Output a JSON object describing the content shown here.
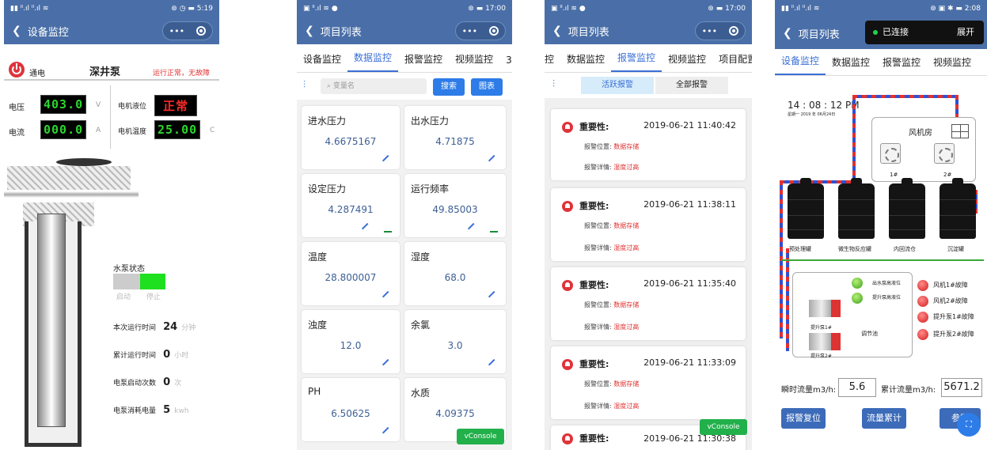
{
  "p1": {
    "status": {
      "left": "▮▮ ᴵᴵ.ıl ᴵᴵ.ıl ≋",
      "right": "⊛ ◷ ▬ 5:19"
    },
    "title": "设备监控",
    "power": "通电",
    "pump_name": "深井泵",
    "run_status": "运行正常，无故障",
    "voltage_label": "电压",
    "voltage": "403.0",
    "voltage_unit": "V",
    "current_label": "电流",
    "current": "000.0",
    "current_unit": "A",
    "level_label": "电机液位",
    "level": "正常",
    "temp_label": "电机温度",
    "temp": "25.00",
    "temp_unit": "C",
    "pump_state": "水泵状态",
    "start": "启动",
    "stop": "停止",
    "rows": [
      {
        "label": "本次运行时间",
        "value": "24",
        "unit": "分钟"
      },
      {
        "label": "累计运行时间",
        "value": "0",
        "unit": "小时"
      },
      {
        "label": "电泵启动次数",
        "value": "0",
        "unit": "次"
      },
      {
        "label": "电泵消耗电量",
        "value": "5",
        "unit": "kwh"
      }
    ]
  },
  "p2": {
    "status": {
      "left": "▣ ᴵᴵ.ıl ≋ ●",
      "right": "⊛ ▬ 17:00"
    },
    "title": "项目列表",
    "tabs": [
      "设备监控",
      "数据监控",
      "报警监控",
      "视频监控",
      "3"
    ],
    "search_placeholder": "变量名",
    "search": "搜索",
    "chart": "图表",
    "cards": [
      {
        "t": "进水压力",
        "v": "4.6675167"
      },
      {
        "t": "出水压力",
        "v": "4.71875"
      },
      {
        "t": "设定压力",
        "v": "4.287491"
      },
      {
        "t": "运行频率",
        "v": "49.85003"
      },
      {
        "t": "温度",
        "v": "28.800007"
      },
      {
        "t": "湿度",
        "v": "68.0"
      },
      {
        "t": "浊度",
        "v": "12.0"
      },
      {
        "t": "余氯",
        "v": "3.0"
      },
      {
        "t": "PH",
        "v": "6.50625"
      },
      {
        "t": "水质",
        "v": "4.09375"
      }
    ],
    "vconsole": "vConsole"
  },
  "p3": {
    "status": {
      "left": "▣ ᴵᴵ.ıl ≋ ●",
      "right": "⊛ ▬ 17:00"
    },
    "title": "项目列表",
    "tabs": [
      "控",
      "数据监控",
      "报警监控",
      "视频监控",
      "项目配置"
    ],
    "active": "活跃报警",
    "all": "全部报警",
    "alarms": [
      {
        "sev": "重要性:",
        "time": "2019-06-21 11:40:42"
      },
      {
        "sev": "重要性:",
        "time": "2019-06-21 11:38:11"
      },
      {
        "sev": "重要性:",
        "time": "2019-06-21 11:35:40"
      },
      {
        "sev": "重要性:",
        "time": "2019-06-21 11:33:09"
      },
      {
        "sev": "重要性:",
        "time": "2019-06-21 11:30:38"
      }
    ],
    "loc_label": "报警位置:",
    "loc": "数据存储",
    "det_label": "报警详情:",
    "det": "湿度过高",
    "vconsole": "vConsole"
  },
  "p4": {
    "status": {
      "left": "▮▮ ᴵᴵ.ıl ᴵᴵ.ıl ≋",
      "right": "⊛ ▣ ✱ ▬ 2:08"
    },
    "title": "项目列表",
    "connected": "已连接",
    "expand": "展开",
    "tabs": [
      "设备监控",
      "数据监控",
      "报警监控",
      "视频监控"
    ],
    "clock": "14 : 08 : 12  PM",
    "date": "星期一  2019 年 06月24日",
    "fan_room": "风机房",
    "fan1": "1#",
    "fan2": "2#",
    "tanks": [
      "预处理罐",
      "微生物反应罐",
      "内回流仓",
      "沉淀罐"
    ],
    "pump1": "提升泵1#",
    "pump2": "提升泵2#",
    "pool": "调节池",
    "high1": "出水泵高液位",
    "high2": "提升泵高液位",
    "faults": [
      "风机1#故障",
      "风机2#故障",
      "提升泵1#故障",
      "提升泵2#故障"
    ],
    "flow_label": "瞬时流量m3/h:",
    "flow": "5.6",
    "total_label": "累计流量m3/h:",
    "total": "5671.2",
    "btn_reset": "报警复位",
    "btn_flow": "流量累计",
    "btn_param": "参数"
  },
  "colors": {
    "header": "#4a6fa8",
    "accent": "#3a6fd6",
    "alarm": "#e0333a",
    "green": "#22b04b"
  }
}
